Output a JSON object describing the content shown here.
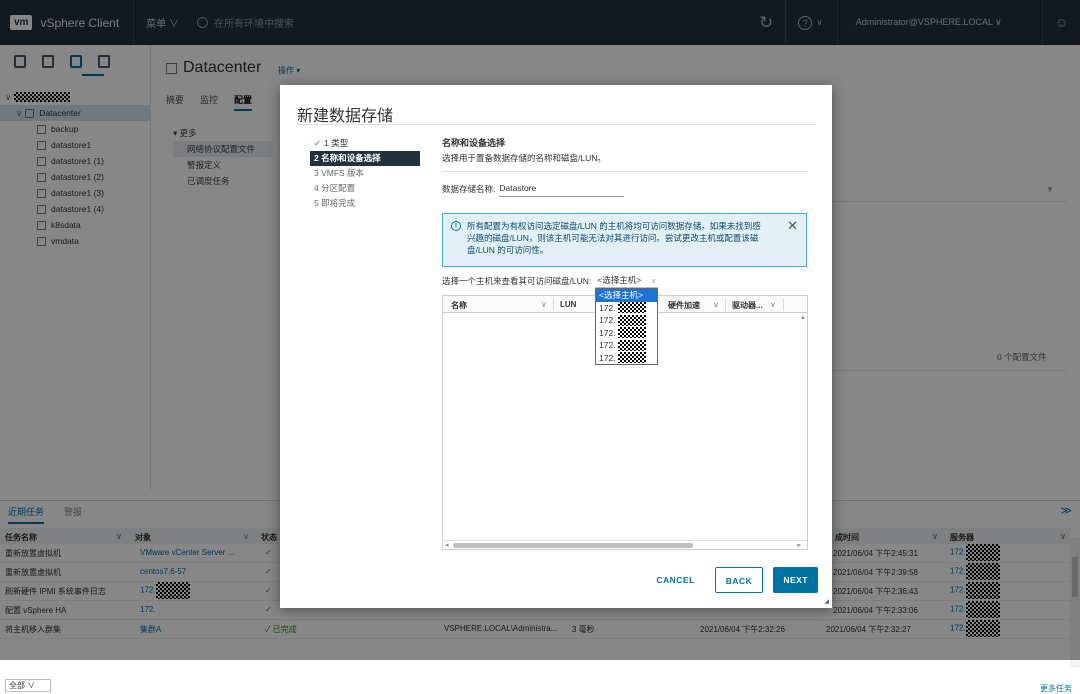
{
  "topbar": {
    "logo": "vm",
    "app_name": "vSphere Client",
    "menu": "菜单 ∨",
    "search_placeholder": "在所有环境中搜索",
    "refresh_icon": "↻",
    "help_icon": "?",
    "help_caret": "∨",
    "user": "Administrator@VSPHERE.LOCAL ∨",
    "smiley": "☺"
  },
  "tree": {
    "datacenter": "Datacenter",
    "items": [
      "backup",
      "datastore1",
      "datastore1 (1)",
      "datastore1 (2)",
      "datastore1 (3)",
      "datastore1 (4)",
      "k8sdata",
      "vmdata"
    ]
  },
  "main": {
    "title": "Datacenter",
    "actions": "操作 ▾",
    "tabs": [
      "摘要",
      "监控",
      "配置"
    ],
    "subnav_header": "▾ 更多",
    "subnav": [
      "网络协议配置文件",
      "警报定义",
      "已调度任务"
    ],
    "right_count": "0 个配置文件",
    "right_filter": "▼"
  },
  "tasks": {
    "tabs": [
      "近期任务",
      "警报"
    ],
    "collapse": "≫",
    "headers": [
      "任务名称",
      "对象",
      "状态",
      "成时间",
      "服务器"
    ],
    "rows": [
      {
        "name": "重新放置虚拟机",
        "object": "VMware vCenter Server ...",
        "status": "✓",
        "time": "2021/06/04 下午2:45:31"
      },
      {
        "name": "重新放置虚拟机",
        "object": "centos7.6-57",
        "status": "✓",
        "time": "2021/06/04 下午2:39:58"
      },
      {
        "name": "刷新硬件 IPMI 系统事件日志",
        "object": "172.",
        "status": "✓",
        "time": "2021/06/04 下午2:36:43"
      },
      {
        "name": "配置 vSphere HA",
        "object": "172.",
        "status": "✓",
        "time": "2021/06/04 下午2:33:06"
      },
      {
        "name": "将主机移入群集",
        "object": "集群A",
        "status": "✓ 已完成",
        "initiator": "VSPHERE.LOCAL\\Administra...",
        "queued": "3 毫秒",
        "start": "2021/06/04 下午2:32:26",
        "time": "2021/06/04 下午2:32:27"
      }
    ],
    "server_prefix": "172.",
    "footer_select": "全部  ∨",
    "more_tasks": "更多任务"
  },
  "wizard": {
    "title": "新建数据存储",
    "steps": [
      {
        "label": "1 类型",
        "state": "done"
      },
      {
        "label": "2 名称和设备选择",
        "state": "active"
      },
      {
        "label": "3 VMFS 版本",
        "state": "pending"
      },
      {
        "label": "4 分区配置",
        "state": "pending"
      },
      {
        "label": "5 即将完成",
        "state": "pending"
      }
    ],
    "section_title": "名称和设备选择",
    "section_desc": "选择用于置备数据存储的名称和磁盘/LUN。",
    "name_label": "数据存储名称:",
    "name_value": "Datastore",
    "info_text": "所有配置为有权访问选定磁盘/LUN 的主机将均可访问数据存储。如果未找到感兴趣的磁盘/LUN，则该主机可能无法对其进行访问。尝试更改主机或配置该磁盘/LUN 的可访问性。",
    "host_label": "选择一个主机来查看其可访问磁盘/LUN:",
    "host_select": "<选择主机>",
    "columns": [
      "名称",
      "LUN",
      "硬件加速",
      "驱动器..."
    ],
    "dropdown": [
      "<选择主机>",
      "172.",
      "172.",
      "172.",
      "172.",
      "172."
    ],
    "buttons": {
      "cancel": "CANCEL",
      "back": "BACK",
      "next": "NEXT"
    }
  }
}
